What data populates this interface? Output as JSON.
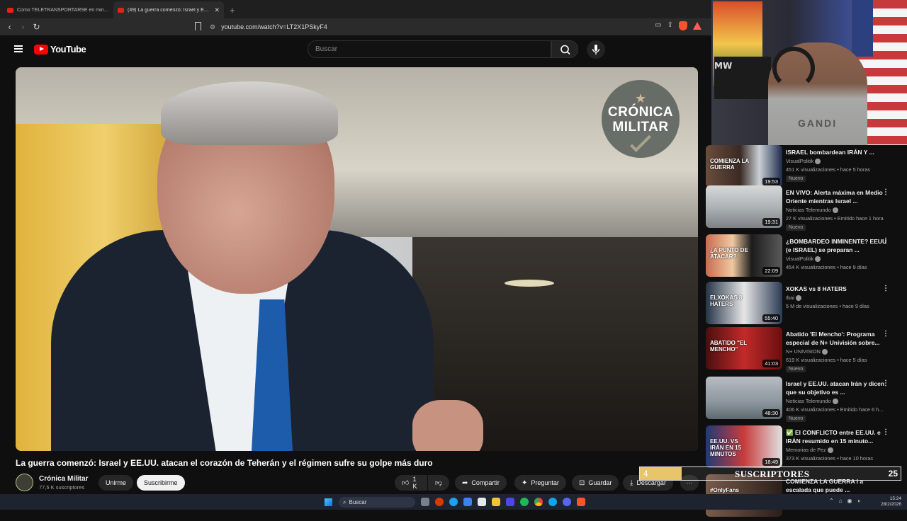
{
  "browser": {
    "tabs": [
      {
        "label": "Como TELETRANSPORTARSE en minecraft"
      },
      {
        "label": "(49) La guerra comenzó: Israel y EE.UU.",
        "active": true
      }
    ],
    "new_tab": "+",
    "url": "youtube.com/watch?v=LT2X1PSkyF4"
  },
  "youtube": {
    "logo_text": "YouTube",
    "search_placeholder": "Buscar"
  },
  "video": {
    "watermark_line1": "CRÓNICA",
    "watermark_line2": "MILITAR",
    "title": "La guerra comenzó: Israel y EE.UU. atacan el corazón de Teherán y el régimen sufre su golpe más duro",
    "channel_name": "Crónica Militar",
    "channel_subs": "77,5 K suscriptores",
    "join_label": "Unirme",
    "subscribe_label": "Suscribirme",
    "likes": "1 K",
    "share_label": "Compartir",
    "ask_label": "Preguntar",
    "save_label": "Guardar",
    "download_label": "Descargar",
    "more": "···"
  },
  "recommendations": [
    {
      "title": "ISRAEL bombardean IRÁN Y ...",
      "channel": "VisualPolitik",
      "meta": "451 K visualizaciones • hace 5 horas",
      "duration": "19:53",
      "badge": "Nuevo",
      "thumb_text": "COMIENZA LA GUERRA"
    },
    {
      "title": "EN VIVO: Alerta máxima en Medio Oriente mientras Israel ...",
      "channel": "Noticias Telemundo",
      "meta": "27 K visualizaciones • Emitido hace 1 hora",
      "duration": "19:31",
      "badge": "Nuevo",
      "thumb_text": ""
    },
    {
      "title": "¿BOMBARDEO INMINENTE? EEUU (e ISRAEL) se preparan ...",
      "channel": "VisualPolitik",
      "meta": "454 K visualizaciones • hace 9 días",
      "duration": "22:09",
      "badge": "",
      "thumb_text": "¿A PUNTO DE ATACAR?"
    },
    {
      "title": "XOKAS vs 8 HATERS",
      "channel": "Ibai",
      "meta": "5 M de visualizaciones • hace 9 días",
      "duration": "55:40",
      "badge": "",
      "thumb_text": "ELXOKAS 8 HATERS"
    },
    {
      "title": "Abatido 'El Mencho': Programa especial de N+ Univisión sobre...",
      "channel": "N+ UNIVISION",
      "meta": "619 K visualizaciones • hace 5 días",
      "duration": "41:03",
      "badge": "Nuevo",
      "thumb_text": "ABATIDO \"EL MENCHO\""
    },
    {
      "title": "Israel y EE.UU. atacan Irán y dicen que su objetivo es ...",
      "channel": "Noticias Telemundo",
      "meta": "406 K visualizaciones • Emitido hace 6 h...",
      "duration": "48:30",
      "badge": "Nuevo",
      "thumb_text": ""
    },
    {
      "title": "✅ El CONFLICTO entre EE.UU. e IRÁN resumido en 15 minuto...",
      "channel": "Memorias de Pez",
      "meta": "373 K visualizaciones • hace 10 horas",
      "duration": "18:49",
      "badge": "",
      "thumb_text": "EE.UU. VS IRÁN EN 15 MINUTOS"
    },
    {
      "title": "COMIENZA LA GUERRA l a escalada que puede ...",
      "channel": "",
      "meta": "",
      "duration": "",
      "badge": "",
      "thumb_text": "#OnlyFans"
    }
  ],
  "webcam": {
    "shirt_text": "GANDI",
    "poster_text": "MW"
  },
  "overlay": {
    "current": "4",
    "label": "SUSCRIPTORES",
    "goal": "25",
    "progress": 0.16
  },
  "taskbar": {
    "search_label": "Buscar",
    "time": "15:24",
    "date": "28/2/2026"
  }
}
